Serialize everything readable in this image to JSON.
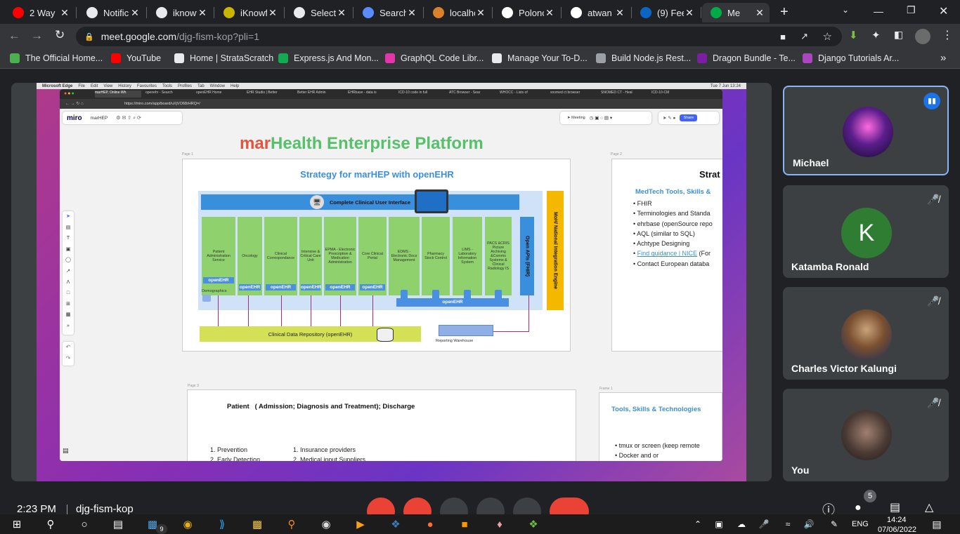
{
  "browser": {
    "tabs": [
      {
        "label": "2 Way",
        "icon": "youtube-icon",
        "color": "#ff0000"
      },
      {
        "label": "Notific",
        "icon": "globe-icon",
        "color": "#e8eaed"
      },
      {
        "label": "iknowf",
        "icon": "globe-icon",
        "color": "#e8eaed"
      },
      {
        "label": "iKnowf",
        "icon": "shield-icon",
        "color": "#c9b600"
      },
      {
        "label": "Select",
        "icon": "globe-icon",
        "color": "#e8eaed"
      },
      {
        "label": "Search",
        "icon": "flag-icon",
        "color": "#5b8cff"
      },
      {
        "label": "localho",
        "icon": "mountain-icon",
        "color": "#d9822b"
      },
      {
        "label": "Polonc",
        "icon": "github-icon",
        "color": "#ffffff"
      },
      {
        "label": "atwan",
        "icon": "github-icon",
        "color": "#ffffff"
      },
      {
        "label": "(9) Fee",
        "icon": "linkedin-icon",
        "color": "#0a66c2"
      },
      {
        "label": "Me",
        "icon": "meet-icon",
        "color": "#00ac47"
      }
    ],
    "new_tab": "+",
    "url_host": "meet.google.com",
    "url_path": "/djg-fism-kop?pli=1",
    "bookmarks": [
      {
        "label": "The Official Home...",
        "color": "#4caf50"
      },
      {
        "label": "YouTube",
        "color": "#ff0000"
      },
      {
        "label": "Home | StrataScratch",
        "color": "#e8eaed"
      },
      {
        "label": "Express.js And Mon...",
        "color": "#13aa52"
      },
      {
        "label": "GraphQL Code Libr...",
        "color": "#e535ab"
      },
      {
        "label": "Manage Your To-D...",
        "color": "#e8eaed"
      },
      {
        "label": "Build Node.js Rest...",
        "color": "#9aa0a6"
      },
      {
        "label": "Dragon Bundle - Te...",
        "color": "#7b1fa2"
      },
      {
        "label": "Django Tutorials Ar...",
        "color": "#ab47bc"
      }
    ],
    "bookmarks_more": "»"
  },
  "screenshare": {
    "mac_menu": [
      "Microsoft Edge",
      "File",
      "Edit",
      "View",
      "History",
      "Favourites",
      "Tools",
      "Profiles",
      "Tab",
      "Window",
      "Help"
    ],
    "mac_clock": "Tue 7 Jun 13:24",
    "edge_tabs": [
      "marHEP, Online Wh",
      "openehr - Search",
      "openEHR Home",
      "EHR Studio | Better",
      "Better EHR Admin",
      "EHRbase - data is",
      "ICD-10 code in full",
      "ATC Browser - Sear",
      "WHOCC - Lists of",
      "snomed ct browser",
      "SNOMED CT - Heal",
      "ICD-10-CM"
    ],
    "edge_url": "https://miro.com/app/board/uXjVO68rHRQ=/",
    "miro_logo": "miro",
    "board_name": "marHEP",
    "meeting_label": "Meeting",
    "share_label": "Share",
    "zoom": "150%",
    "title_mar": "mar",
    "title_rest": "Health Enterprise Platform",
    "page1": {
      "page_label": "Page 1",
      "heading": "Strategy for marHEP with openEHR",
      "cui": "Complete Clinical User Interface",
      "modules": [
        "Patient Administration Service",
        "Oncology",
        "Clinical Correspondance",
        "Intensive & Critical Care Unit",
        "EPMA - Electronic Prescription & Medication Administration",
        "Core Clinical Portal",
        "EDMS - Electronic Docs Management",
        "Pharmacy Stock Control",
        "LIMS - Laboratory Information System",
        "PACS &CRIS Picture Archiving &Comms Systems & Clinical Radiology IS"
      ],
      "openehr": "openEHR",
      "demographics": "Demographics",
      "open_apis": "Open APIs (FHIR)",
      "integration_engine": "MoH/ National Integration Engine",
      "cdr": "Clinical Data Repository (openEHR)",
      "reporting": "Reporting Warehouse"
    },
    "page2": {
      "page_label": "Page 2",
      "heading": "Strat",
      "subheading": "MedTech Tools, Skills &",
      "items": [
        "FHIR",
        "Terminologies and Standa",
        "ehrbase (openSource repo",
        "AQL  (similar to SQL)",
        "Achtype Designing",
        "Contact European databa"
      ],
      "link_text": "Find guidance | NICE",
      "link_suffix": " (For"
    },
    "page3": {
      "page_label": "Page 3",
      "heading": "Patient   ( Admission; Diagnosis and Treatment); Discharge",
      "col1": [
        "1. Prevention",
        "2. Early Detection"
      ],
      "col2": [
        "1. Insurance providers",
        "2. Medical input Suppliers"
      ]
    },
    "frame1": {
      "page_label": "Frame 1",
      "heading": "Tools, Skills & Technologies",
      "items": [
        "tmux or screen (keep remote",
        "Docker and or"
      ]
    }
  },
  "participants": [
    {
      "name": "Michael",
      "speaking": true
    },
    {
      "name": "Katamba Ronald",
      "initial": "K",
      "avatar_color": "#2e7d32"
    },
    {
      "name": "Charles Victor Kalungi"
    },
    {
      "name": "You"
    }
  ],
  "meeting": {
    "time": "2:23 PM",
    "code": "djg-fism-kop",
    "participant_count": "5"
  },
  "taskbar": {
    "badge": "9",
    "lang": "ENG",
    "time": "14:24",
    "date": "07/06/2022"
  }
}
